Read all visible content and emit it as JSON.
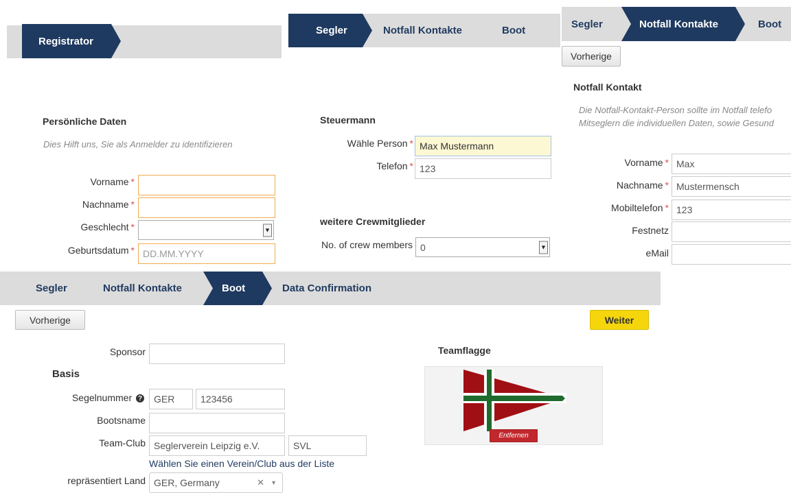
{
  "panel1": {
    "tab": "Registrator",
    "section_title": "Persönliche Daten",
    "hint": "Dies Hilft uns, Sie als Anmelder zu identifizieren",
    "fields": {
      "vorname_label": "Vorname",
      "nachname_label": "Nachname",
      "geschlecht_label": "Geschlecht",
      "geburtsdatum_label": "Geburtsdatum",
      "geburtsdatum_placeholder": "DD.MM.YYYY"
    },
    "required_mark": "*"
  },
  "panel2": {
    "tabs": [
      "Segler",
      "Notfall Kontakte",
      "Boot"
    ],
    "section_title": "Steuermann",
    "person_label": "Wähle Person",
    "person_value": "Max Mustermann",
    "telefon_label": "Telefon",
    "telefon_value": "123",
    "crew_title": "weitere Crewmitglieder",
    "crew_label": "No. of crew members",
    "crew_value": "0"
  },
  "panel3": {
    "tabs": [
      "Segler",
      "Notfall Kontakte",
      "Boot"
    ],
    "prev_button": "Vorherige",
    "section_title": "Notfall Kontakt",
    "hint_line1": "Die Notfall-Kontakt-Person sollte im Notfall telefo",
    "hint_line2": "Mitseglern die individuellen Daten, sowie Gesund",
    "vorname_label": "Vorname",
    "vorname_value": "Max",
    "nachname_label": "Nachname",
    "nachname_value": "Mustermensch",
    "mobil_label": "Mobiltelefon",
    "mobil_value": "123",
    "festnetz_label": "Festnetz",
    "email_label": "eMail"
  },
  "panel4": {
    "tabs": [
      "Segler",
      "Notfall Kontakte",
      "Boot",
      "Data Confirmation"
    ],
    "prev_button": "Vorherige",
    "next_button": "Weiter",
    "sponsor_label": "Sponsor",
    "basis_title": "Basis",
    "segelnummer_label": "Segelnummer",
    "segel_country": "GER",
    "segel_number": "123456",
    "bootsname_label": "Bootsname",
    "teamclub_label": "Team-Club",
    "club_name": "Seglerverein Leipzig e.V.",
    "club_short": "SVL",
    "club_link": "Wählen Sie einen Verein/Club aus der Liste",
    "land_label": "repräsentiert Land",
    "land_value": "GER, Germany",
    "teamflagge_title": "Teamflagge",
    "remove_button": "Entfernen"
  },
  "colors": {
    "accent": "#1f3a60",
    "required": "#d9534f",
    "warning_border": "#f0ad4e",
    "flag_red": "#a00f14",
    "flag_green": "#1f6b2e",
    "next_yellow": "#f5d60c"
  }
}
